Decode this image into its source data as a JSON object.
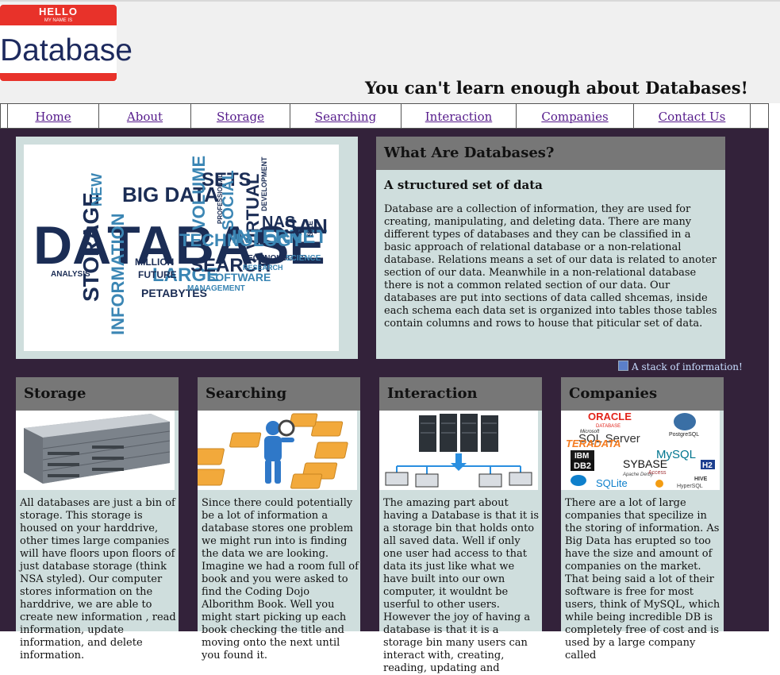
{
  "logo": {
    "hello": "HELLO",
    "my_name_is": "MY NAME IS",
    "word": "Database"
  },
  "tagline": "You can't learn enough about Databases!",
  "nav": [
    {
      "label": "Home"
    },
    {
      "label": "About"
    },
    {
      "label": "Storage"
    },
    {
      "label": "Searching"
    },
    {
      "label": "Interaction"
    },
    {
      "label": "Companies"
    },
    {
      "label": "Contact Us"
    }
  ],
  "hero_image": {
    "words": [
      "DATABASE",
      "BIG DATA",
      "VOLUME",
      "SETS",
      "SOCIAL",
      "VIRTUAL",
      "TECHNOLOGY",
      "INTERNET",
      "NAS",
      "SAN",
      "STORAGE",
      "INFORMATION",
      "LARGE",
      "SEARCH",
      "SOFTWARE",
      "PETABYTES",
      "ANALYSIS",
      "MANAGEMENT",
      "TECHNOLOGIES",
      "RESEARCH",
      "SCIENCE",
      "MILLION",
      "FUTURE",
      "NEW",
      "DEVELOPMENT",
      "PROFESSIONAL",
      "SIZE"
    ]
  },
  "what": {
    "heading": "What Are Databases?",
    "subheading": "A structured set of data",
    "text": "Database are a collection of information, they are used for creating, manipulating, and deleting data. There are many different types of databases and they can be classified in a basic approach of relational database or a non-relational database. Relations means a set of our data is related to anoter section of our data. Meanwhile in a non-relational database there is not a common related section of our data. Our databases are put into sections of data called shcemas, inside each schema each data set is organized into tables those tables contain columns and rows to house that piticular set of data."
  },
  "caption": "A stack of information!",
  "cards": [
    {
      "heading": "Storage",
      "text": "All databases are just a bin of storage. This storage is housed on your harddrive, other times large companies will have floors upon floors of just database storage (think NSA styled). Our computer stores information on the harddrive, we are able to create new information , read information, update information, and delete information."
    },
    {
      "heading": "Searching",
      "text": "Since there could potentially be a lot of information a database stores one problem we might run into is finding the data we are looking. Imagine we had a room full of book and you were asked to find the Coding Dojo Alborithm Book. Well you might start picking up each book checking the title and moving onto the next until you found it."
    },
    {
      "heading": "Interaction",
      "text": "The amazing part about having a Database is that it is a storage bin that holds onto all saved data. Well if only one user had access to that data its just like what we have built into our own computer, it wouldnt be userful to other users. However the joy of having a database is that it is a storage bin many users can interact with, creating, reading, updating and"
    },
    {
      "heading": "Companies",
      "text": "There are a lot of large companies that specilize in the storing of information. As Big Data has erupted so too have the size and amount of companies on the market. That being said a lot of their software is free for most users, think of MySQL, which while being incredible DB is completely free of cost and is used by a large company called"
    }
  ],
  "companies_logos": {
    "oracle": "ORACLE",
    "oracle_sub": "DATABASE",
    "microsoft": "Microsoft",
    "sqlserver": "SQL Server",
    "postgres": "PostgreSQL",
    "teradata": "TERADATA",
    "ibm": "IBM",
    "db2": "DB2",
    "mysql": "MySQL",
    "sybase": "SYBASE",
    "h2": "H2",
    "sqlite": "SQLite",
    "hive": "HIVE",
    "hypersql": "HyperSQL",
    "apache": "Apache Derby",
    "access": "Access"
  },
  "colors": {
    "main_bg": "#33223a",
    "panel_bg": "#cfdedd",
    "heading_bg": "#777777",
    "logo_red": "#e8322a",
    "logo_text": "#1d2a5e",
    "link": "#551a8b"
  },
  "icons": {
    "caption": "image-icon"
  }
}
